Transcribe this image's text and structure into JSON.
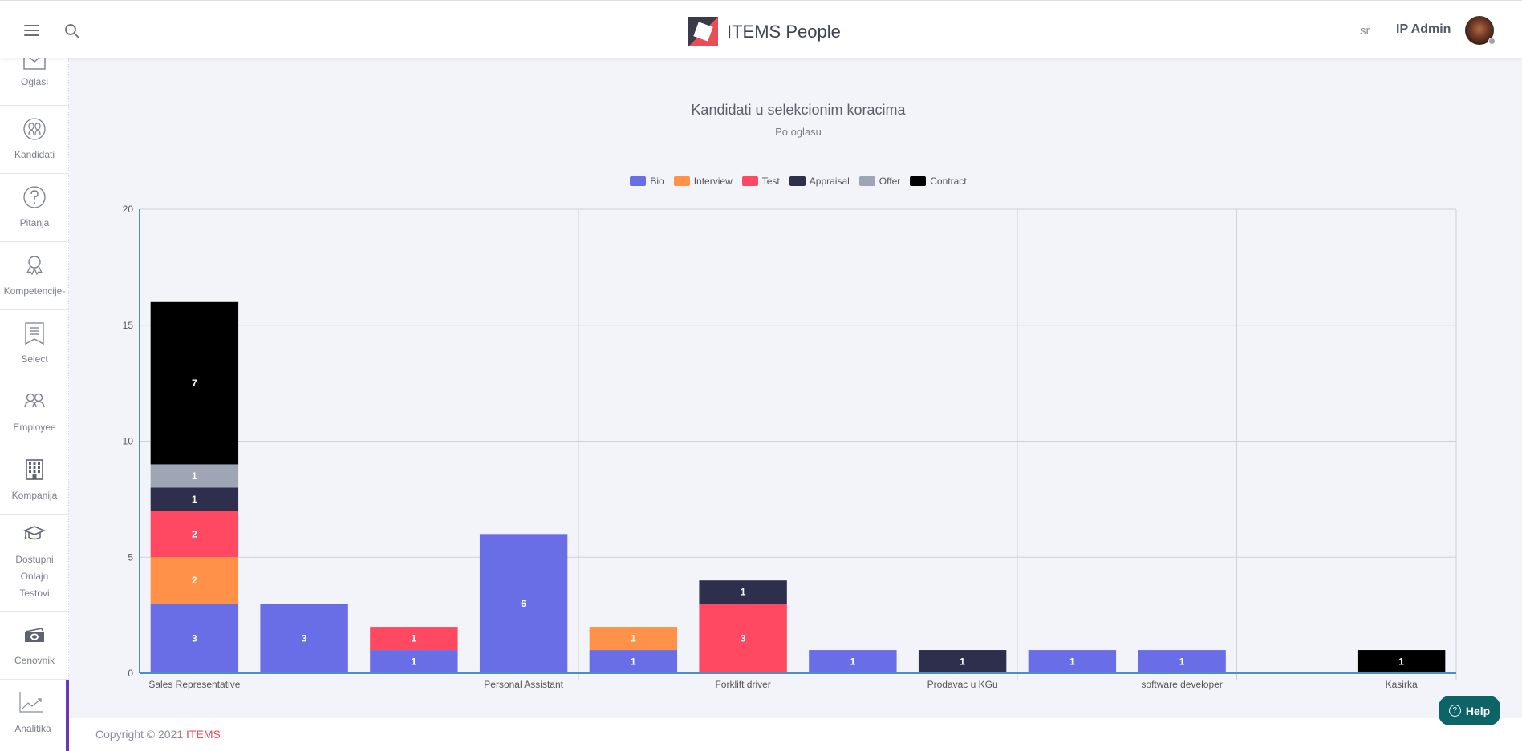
{
  "header": {
    "app_name": "ITEMS People",
    "language": "sr",
    "user_name": "IP Admin"
  },
  "sidebar": {
    "items": [
      {
        "label": "Oglasi",
        "icon": "envelope-icon"
      },
      {
        "label": "Kandidati",
        "icon": "candidates-icon"
      },
      {
        "label": "Pitanja",
        "icon": "question-icon"
      },
      {
        "label": "Kompetencije-",
        "icon": "award-icon"
      },
      {
        "label": "Select",
        "icon": "bookmark-list-icon"
      },
      {
        "label": "Employee",
        "icon": "users-icon"
      },
      {
        "label": "Kompanija",
        "icon": "building-icon"
      },
      {
        "label": "Dostupni Onlajn Testovi",
        "icon": "graduation-cap-icon"
      },
      {
        "label": "Cenovnik",
        "icon": "money-icon"
      },
      {
        "label": "Analitika",
        "icon": "chart-line-icon",
        "active": true
      }
    ]
  },
  "footer": {
    "copyright": "Copyright © 2021 ",
    "brand": "ITEMS"
  },
  "help": {
    "label": "Help"
  },
  "chart_data": {
    "type": "bar",
    "stacked": true,
    "title": "Kandidati u selekcionim koracima",
    "subtitle": "Po oglasu",
    "xlabel": "",
    "ylabel": "",
    "ylim": [
      0,
      20
    ],
    "yticks": [
      0,
      5,
      10,
      15,
      20
    ],
    "grid": true,
    "legend_position": "top",
    "categories": [
      "Sales Representative",
      "",
      "Personal Assistant",
      "",
      "Forklift driver",
      "",
      "Prodavac u KGu",
      "",
      "software developer",
      "",
      "Kasirka",
      ""
    ],
    "tick_labels": [
      "Sales Representative",
      "Personal Assistant",
      "Forklift driver",
      "Prodavac u KGu",
      "software developer",
      "Kasirka"
    ],
    "series": [
      {
        "name": "Bio",
        "color": "#6a6ee6",
        "values": [
          3,
          3,
          1,
          6,
          1,
          0,
          1,
          0,
          1,
          1,
          0,
          0
        ]
      },
      {
        "name": "Interview",
        "color": "#ff9148",
        "values": [
          2,
          0,
          0,
          0,
          1,
          0,
          0,
          0,
          0,
          0,
          0,
          0
        ]
      },
      {
        "name": "Test",
        "color": "#ff4862",
        "values": [
          2,
          0,
          1,
          0,
          0,
          3,
          0,
          0,
          0,
          0,
          0,
          0
        ]
      },
      {
        "name": "Appraisal",
        "color": "#2e2f4d",
        "values": [
          1,
          0,
          0,
          0,
          0,
          1,
          0,
          1,
          0,
          0,
          0,
          0
        ]
      },
      {
        "name": "Offer",
        "color": "#9ea5b4",
        "values": [
          1,
          0,
          0,
          0,
          0,
          0,
          0,
          0,
          0,
          0,
          0,
          0
        ]
      },
      {
        "name": "Contract",
        "color": "#000000",
        "values": [
          7,
          0,
          0,
          0,
          0,
          0,
          0,
          0,
          0,
          0,
          0,
          1
        ]
      }
    ]
  }
}
